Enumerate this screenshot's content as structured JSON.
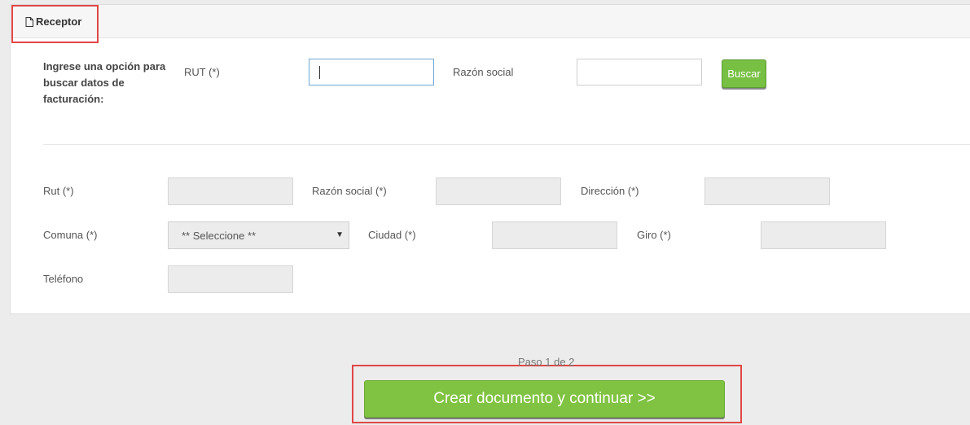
{
  "section": {
    "title": "Receptor",
    "icon": "document-icon"
  },
  "search": {
    "instruction": [
      "Ingrese una opción para",
      "buscar datos de",
      "facturación:"
    ],
    "rut_label": "RUT (*)",
    "rut_value": "",
    "razon_label": "Razón social",
    "razon_value": "",
    "button_label": "Buscar"
  },
  "form": {
    "rut_label": "Rut (*)",
    "razon_label": "Razón social (*)",
    "direccion_label": "Dirección (*)",
    "comuna_label": "Comuna (*)",
    "comuna_selected": "** Seleccione **",
    "ciudad_label": "Ciudad (*)",
    "giro_label": "Giro (*)",
    "telefono_label": "Teléfono"
  },
  "footer": {
    "step_text": "Paso 1 de 2",
    "submit_label": "Crear documento y continuar >>"
  },
  "colors": {
    "accent_green": "#80c342",
    "highlight_red": "#e04646",
    "focus_blue": "#6ea7d6"
  }
}
